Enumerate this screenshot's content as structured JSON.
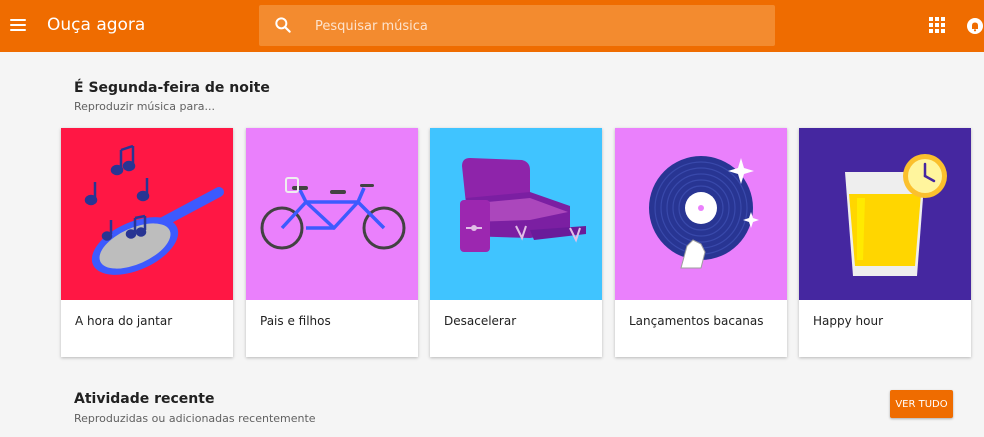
{
  "header": {
    "title": "Ouça agora",
    "search_placeholder": "Pesquisar música",
    "bg_color": "#ef6c00",
    "menu_icon": "hamburger-menu-icon",
    "apps_icon": "apps-grid-icon",
    "notifications_icon": "notification-bell-icon"
  },
  "section_greeting": {
    "title": "É Segunda-feira de noite",
    "subtitle": "Reproduzir música para..."
  },
  "cards": [
    {
      "label": "A hora do jantar",
      "bg_color": "#ff1744",
      "icon": "frying-pan-music-notes-icon"
    },
    {
      "label": "Pais e filhos",
      "bg_color": "#ea80fc",
      "icon": "tandem-bicycle-icon"
    },
    {
      "label": "Desacelerar",
      "bg_color": "#40c4ff",
      "icon": "recliner-chair-icon"
    },
    {
      "label": "Lançamentos bacanas",
      "bg_color": "#ea80fc",
      "icon": "vinyl-record-icon"
    },
    {
      "label": "Happy hour",
      "bg_color": "#4527a0",
      "icon": "drink-glass-clock-icon"
    }
  ],
  "section_recent": {
    "title": "Atividade recente",
    "subtitle": "Reproduzidas ou adicionadas recentemente",
    "see_all_label": "VER TUDO"
  }
}
